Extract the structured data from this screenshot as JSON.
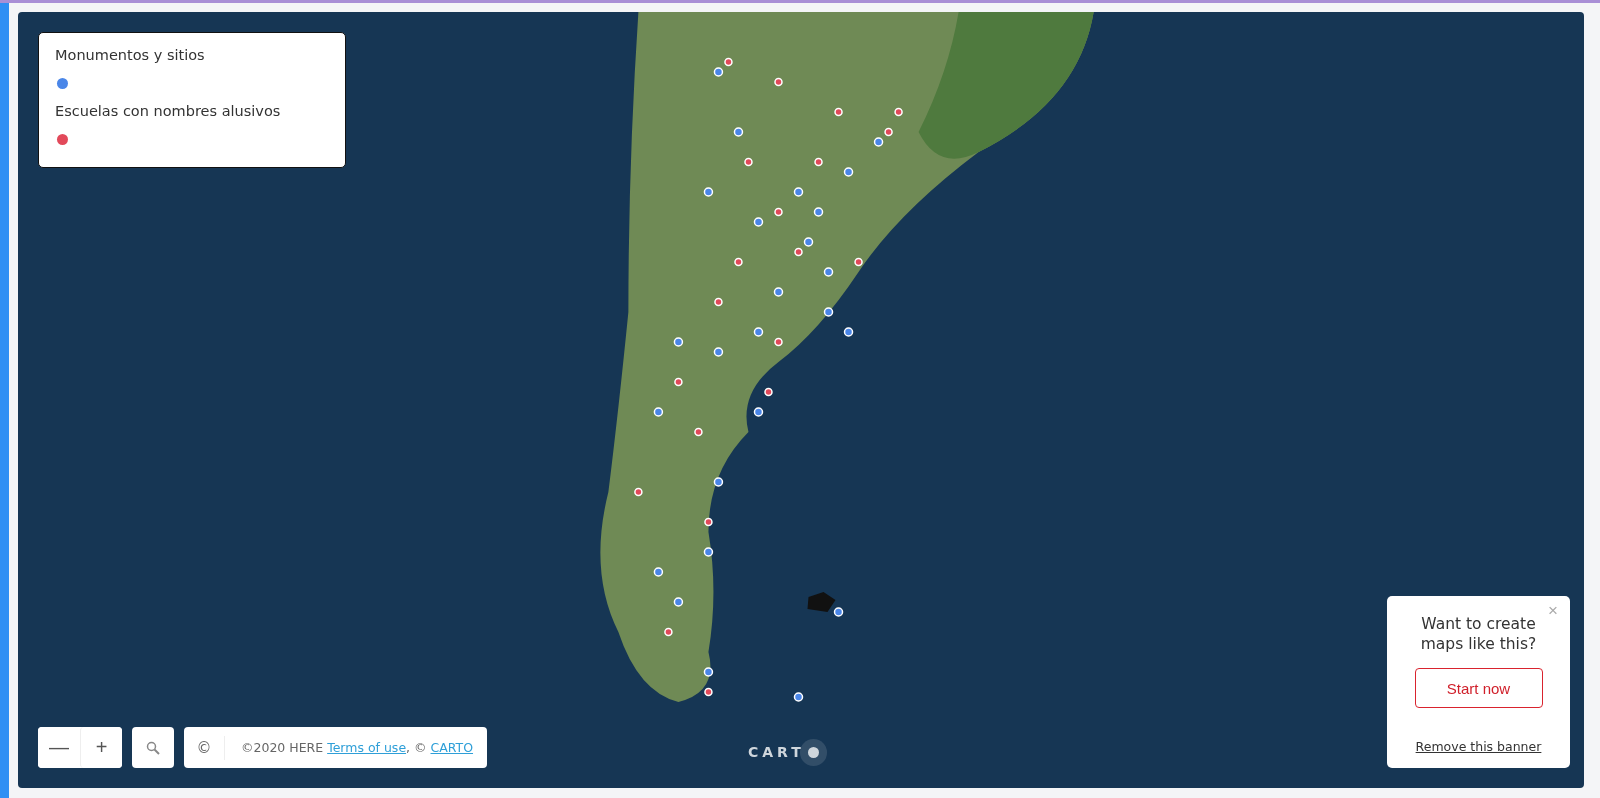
{
  "legend": {
    "items": [
      {
        "label": "Monumentos y sitios",
        "color": "#4a86e8"
      },
      {
        "label": "Escuelas con nombres alusivos",
        "color": "#e2495a"
      }
    ]
  },
  "zoom_controls": {
    "minus": "—",
    "plus": "+"
  },
  "attribution": {
    "symbol": "©",
    "prefix": "©2020 HERE",
    "terms_link": "Terms of use",
    "separator": ", ©",
    "carto_link": "CARTO"
  },
  "logo": {
    "text": "CART"
  },
  "banner": {
    "close": "×",
    "title": "Want to create maps like this?",
    "button": "Start now",
    "link": "Remove this banner"
  }
}
